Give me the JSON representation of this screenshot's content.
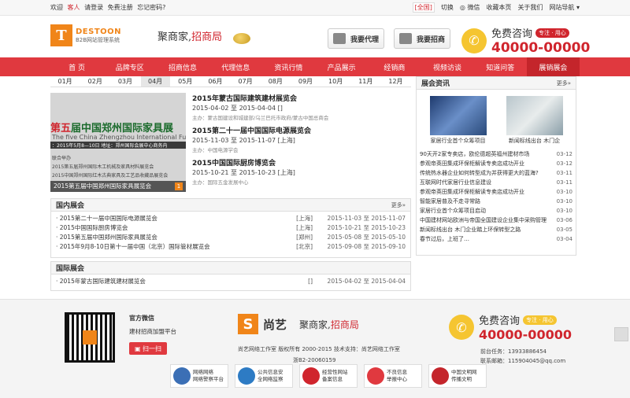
{
  "topbar": {
    "welcome": "欢迎",
    "guest": "客人",
    "login": "请登录",
    "register": "免费注册",
    "forgot": "忘记密码?",
    "city": "[全国]",
    "switch": "切换",
    "weixin": "微信",
    "bookmark": "收藏本页",
    "about": "关于我们",
    "sitenav": "网站导航"
  },
  "header": {
    "logo_mark": "T",
    "logo_brand": "DESTOON",
    "logo_sub": "B2B网站管理系统",
    "slogan_a": "聚商家,",
    "slogan_b": "招商局",
    "btn_agent": "我要代理",
    "btn_invest": "我要招商",
    "hotline_label": "免费咨询",
    "hotline_tag": "专注 · 用心",
    "hotline_number": "40000-00000"
  },
  "nav": [
    "首 页",
    "品牌专区",
    "招商信息",
    "代理信息",
    "资讯行情",
    "产品展示",
    "经销商",
    "视频访谈",
    "知道问答",
    "展销展会"
  ],
  "months": [
    "01月",
    "02月",
    "03月",
    "04月",
    "05月",
    "06月",
    "07月",
    "08月",
    "09月",
    "10月",
    "11月",
    "12月"
  ],
  "featured": {
    "big_a": "第五",
    "big_b": "届中国郑州国际家具展",
    "en": "The five China Zhengzhou International Furniture",
    "date": "：2015年5月8—10日  地址：郑州国际会展中心商务内",
    "l1": "联合举办",
    "l2": "2015第五届郑州国际木工机械及家具材料展览会",
    "l3": "2015中国郑州国际红木古典家具及工艺品收藏品展览会",
    "caption": "2015第五届中国郑州国际家具展览会",
    "page": "1"
  },
  "feat_list": [
    {
      "title": "2015年蒙古国际建筑建材展览会",
      "date": "2015-04-02 至 2015-04-04 []",
      "host": "主办：蒙古国建设和城建部/乌兰巴托市政府/蒙古中国总商会"
    },
    {
      "title": "2015第二十一届中国国际电源展览会",
      "date": "2015-11-03 至 2015-11-07 [上海]",
      "host": "主办：中国电源学会"
    },
    {
      "title": "2015中国国际厨房博览会",
      "date": "2015-10-21 至 2015-10-23 [上海]",
      "host": "主办：国际五金发展中心"
    }
  ],
  "domestic": {
    "title": "国内展会",
    "more": "更多»",
    "rows": [
      {
        "name": "· 2015第二十一届中国国际电源展览会",
        "loc": "[上海]",
        "date": "2015-11-03 至 2015-11-07"
      },
      {
        "name": "· 2015中国国际厨房博览会",
        "loc": "[上海]",
        "date": "2015-10-21 至 2015-10-23"
      },
      {
        "name": "· 2015第五届中国郑州国际家具展览会",
        "loc": "[郑州]",
        "date": "2015-05-08 至 2015-05-10"
      },
      {
        "name": "· 2015年9月8-10日第十一届中国（北京）国际管材展览会",
        "loc": "[北京]",
        "date": "2015-09-08 至 2015-09-10"
      }
    ]
  },
  "intl": {
    "title": "国际展会",
    "rows": [
      {
        "name": "· 2015年蒙古国际建筑建材展览会",
        "loc": "[]",
        "date": "2015-04-02 至 2015-04-04"
      }
    ]
  },
  "news": {
    "title": "展会资讯",
    "more": "更多»",
    "img1": "家居行业首个众筹项目",
    "img2": "新闻标线出台 木门企",
    "items": [
      {
        "t": "90天开2家专卖店，欧伦德超英福州建材市场",
        "d": "03-12"
      },
      {
        "t": "参观帝英田集成环保柜解读专卖店成功开业",
        "d": "03-12"
      },
      {
        "t": "传统热水器企业如何转型成为并获得更大的蓝海?",
        "d": "03-11"
      },
      {
        "t": "互联网时代家居行业信息建设",
        "d": "03-11"
      },
      {
        "t": "参观帝英田集成环保柜解读专卖店成功开业",
        "d": "03-10"
      },
      {
        "t": "智能家居普及不走寻常路",
        "d": "03-10"
      },
      {
        "t": "家居行业首个众筹项目启动",
        "d": "03-10"
      },
      {
        "t": "中国建材网站欧洲与帝国全国建设企业集中采购管理",
        "d": "03-06"
      },
      {
        "t": "新闻标线出台 木门企业踏上环保转型之路",
        "d": "03-05"
      },
      {
        "t": "春节过后，上班了…",
        "d": "03-04"
      }
    ]
  },
  "footer": {
    "wx_title": "官方微信",
    "wx_sub": "建材招商加盟平台",
    "wx_btn": "扫一扫",
    "brand_mark": "S",
    "brand_name": "尚艺",
    "slogan_a": "聚商家,",
    "slogan_b": "招商局",
    "copyright": "尚艺网络工作室  版权所有 2000-2015 技术支持：尚艺网络工作室",
    "icp": "浙B2-20060159",
    "hot_label": "免费咨询",
    "hot_tag": "专注 · 用心",
    "hot_number": "40000-00000",
    "phone": "前台任务：13933886454",
    "email": "联系邮箱：115904045@qq.com",
    "badges": [
      {
        "a": "网络网络",
        "b": "网络警察平台"
      },
      {
        "a": "公共信息安",
        "b": "全网络监察"
      },
      {
        "a": "经营性网站",
        "b": "备案信息"
      },
      {
        "a": "不良信息",
        "b": "举报中心"
      },
      {
        "a": "中国文明网",
        "b": "传播文明"
      }
    ]
  },
  "colors": {
    "accent": "#e0393f",
    "orange": "#f08519",
    "gold": "#f5c531"
  }
}
